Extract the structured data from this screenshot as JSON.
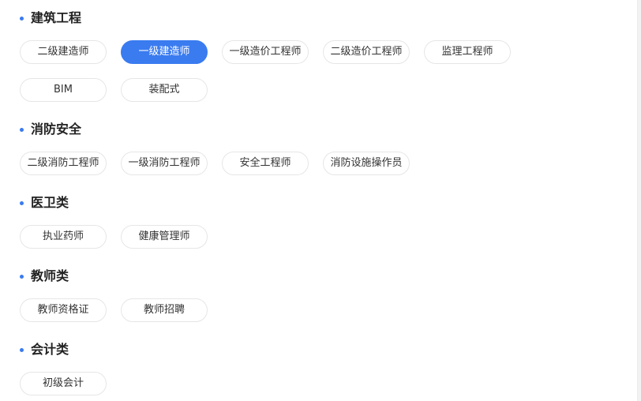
{
  "sections": [
    {
      "title": "建筑工程",
      "items": [
        {
          "label": "二级建造师",
          "active": false
        },
        {
          "label": "一级建造师",
          "active": true
        },
        {
          "label": "一级造价工程师",
          "active": false
        },
        {
          "label": "二级造价工程师",
          "active": false
        },
        {
          "label": "监理工程师",
          "active": false
        },
        {
          "label": "BIM",
          "active": false
        },
        {
          "label": "装配式",
          "active": false
        }
      ]
    },
    {
      "title": "消防安全",
      "items": [
        {
          "label": "二级消防工程师",
          "active": false
        },
        {
          "label": "一级消防工程师",
          "active": false
        },
        {
          "label": "安全工程师",
          "active": false
        },
        {
          "label": "消防设施操作员",
          "active": false
        }
      ]
    },
    {
      "title": "医卫类",
      "items": [
        {
          "label": "执业药师",
          "active": false
        },
        {
          "label": "健康管理师",
          "active": false
        }
      ]
    },
    {
      "title": "教师类",
      "items": [
        {
          "label": "教师资格证",
          "active": false
        },
        {
          "label": "教师招聘",
          "active": false
        }
      ]
    },
    {
      "title": "会计类",
      "items": [
        {
          "label": "初级会计",
          "active": false
        }
      ]
    }
  ],
  "colors": {
    "accent": "#3a7bf0",
    "chip_border": "#e6e6e6",
    "text": "#333333",
    "title": "#222222"
  }
}
